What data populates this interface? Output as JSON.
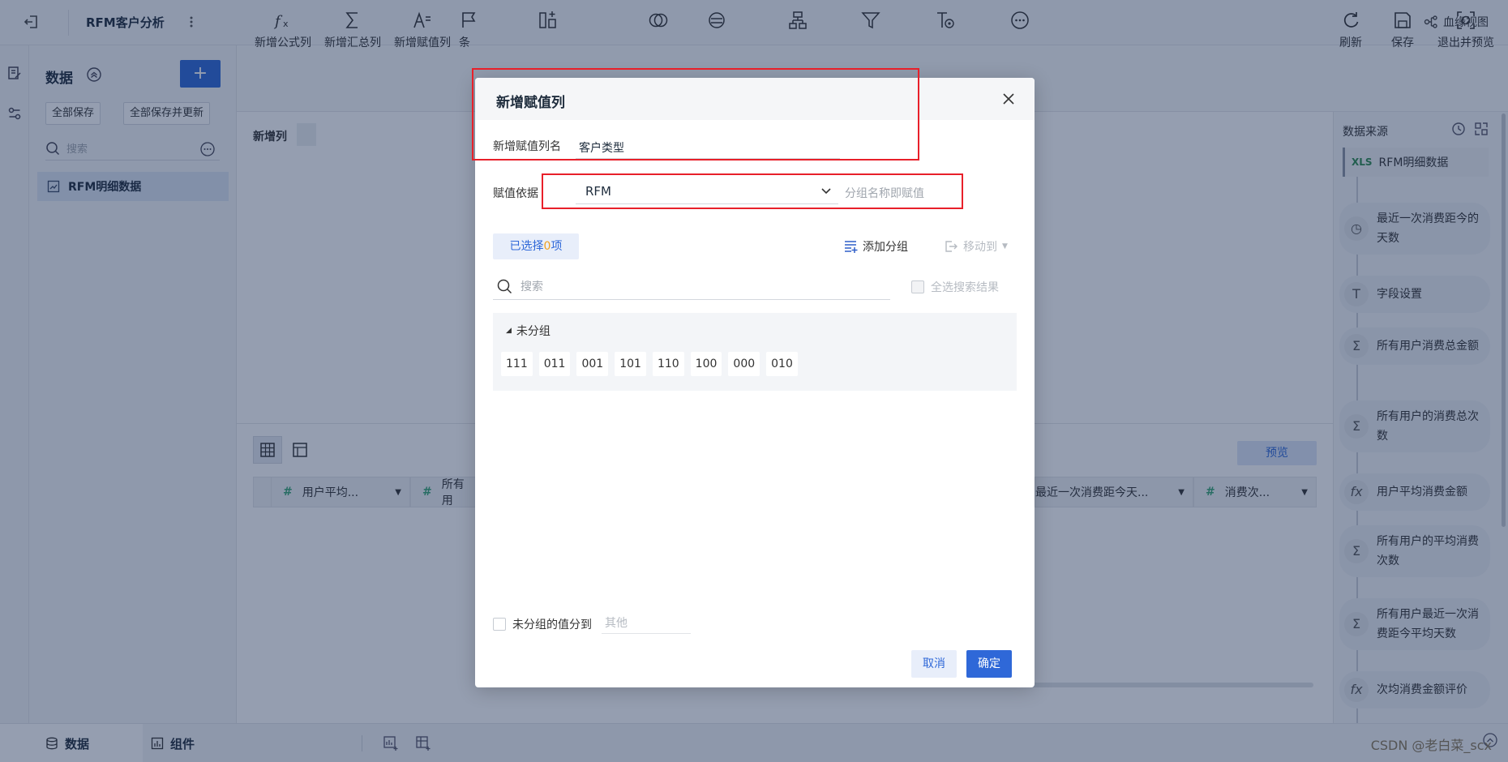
{
  "app": {
    "title": "RFM客户分析",
    "lineage_label": "血缘视图"
  },
  "data_panel": {
    "title": "数据",
    "add_label": "+",
    "save_all": "全部保存",
    "save_all_update": "全部保存并更新",
    "search_placeholder": "搜索",
    "dataset_name": "RFM明细数据"
  },
  "toolbar": {
    "items": [
      {
        "label": "新增公式列",
        "icon": "fx-icon"
      },
      {
        "label": "新增汇总列",
        "icon": "sigma-icon"
      },
      {
        "label": "新增赋值列",
        "icon": "assign-icon"
      },
      {
        "label": "条",
        "icon": "flag-icon"
      }
    ],
    "right": [
      {
        "label": "刷新",
        "icon": "refresh-icon"
      },
      {
        "label": "保存",
        "icon": "save-icon"
      },
      {
        "label": "退出并预览",
        "icon": "exit-preview-icon"
      }
    ]
  },
  "main": {
    "new_column_label": "新增列",
    "preview_label": "预览",
    "columns": [
      {
        "name": "用户平均..."
      },
      {
        "name": "所有用"
      },
      {
        "name": "最近一次消费距今天..."
      },
      {
        "name": "消费次..."
      }
    ]
  },
  "right_panel": {
    "source_label": "数据来源",
    "source_name": "RFM明细数据",
    "steps": [
      {
        "label": "最近一次消费距今的天数",
        "icon": "clock-icon"
      },
      {
        "label": "字段设置",
        "icon": "field-setting-icon"
      },
      {
        "label": "所有用户消费总金额",
        "icon": "sigma-icon"
      },
      {
        "label": "所有用户的消费总次数",
        "icon": "sigma-icon"
      },
      {
        "label": "用户平均消费金额",
        "icon": "fx-icon"
      },
      {
        "label": "所有用户的平均消费次数",
        "icon": "sigma-icon"
      },
      {
        "label": "所有用户最近一次消费距今平均天数",
        "icon": "sigma-icon"
      },
      {
        "label": "次均消费金额评价",
        "icon": "fx-icon"
      }
    ]
  },
  "bottom": {
    "tab_data": "数据",
    "tab_component": "组件"
  },
  "watermark": "CSDN @老白菜_scx",
  "dialog": {
    "title": "新增赋值列",
    "name_label": "新增赋值列名",
    "name_value": "客户类型",
    "basis_label": "赋值依据",
    "basis_value": "RFM",
    "basis_hint": "分组名称即赋值",
    "selected_prefix": "已选择",
    "selected_count": "0",
    "selected_suffix": "项",
    "add_group": "添加分组",
    "move_to": "移动到",
    "search_placeholder": "搜索",
    "select_all_results": "全选搜索结果",
    "ungrouped_title": "未分组",
    "values": [
      "111",
      "011",
      "001",
      "101",
      "110",
      "100",
      "000",
      "010"
    ],
    "ungrouped_to_label": "未分组的值分到",
    "ungrouped_to_placeholder": "其他",
    "cancel": "取消",
    "ok": "确定"
  },
  "colors": {
    "primary": "#2f68d8",
    "highlight": "#e8202a",
    "count": "#f0a020"
  }
}
